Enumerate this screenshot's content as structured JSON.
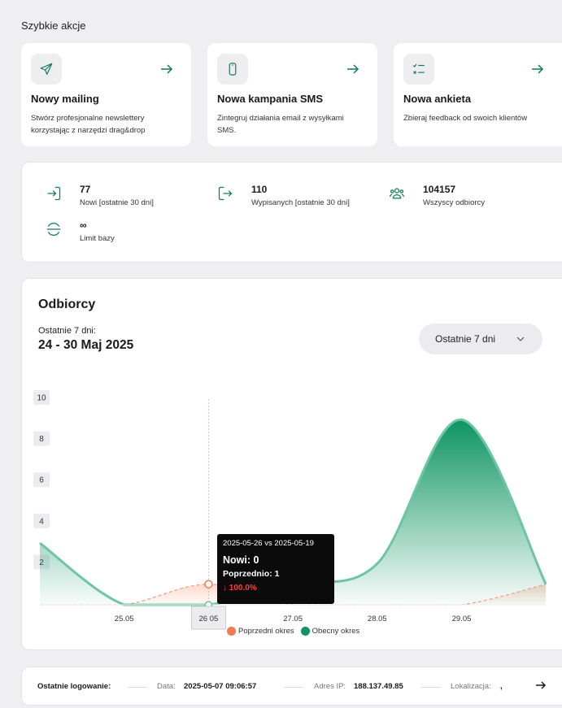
{
  "quick_actions": {
    "title": "Szybkie akcje",
    "items": [
      {
        "icon": "paper-plane-icon",
        "title": "Nowy mailing",
        "description": "Stwórz profesjonalne newslettery korzystając z narzędzi drag&drop"
      },
      {
        "icon": "mobile-phone-icon",
        "title": "Nowa kampania SMS",
        "description": "Zintegruj działania email z wysyłkami SMS."
      },
      {
        "icon": "checklist-icon",
        "title": "Nowa ankieta",
        "description": "Zbieraj feedback od swoich klientów"
      }
    ]
  },
  "stats": [
    {
      "icon": "sign-in-icon",
      "value": "77",
      "label": "Nowi [ostatnie 30 dni]"
    },
    {
      "icon": "sign-out-icon",
      "value": "110",
      "label": "Wypisanych [ostatnie 30 dni]"
    },
    {
      "icon": "users-group-icon",
      "value": "104157",
      "label": "Wszyscy odbiorcy"
    },
    {
      "icon": "database-limit-icon",
      "value": "∞",
      "label": "Limit bazy"
    }
  ],
  "chart_card": {
    "title": "Odbiorcy",
    "period_label": "Ostatnie 7 dni:",
    "period_range": "24 - 30 Maj 2025",
    "range_select": "Ostatnie 7 dni",
    "tooltip": {
      "header": "2025-05-26 vs 2025-05-19",
      "main": "Nowi: 0",
      "previous": "Poprzednio: 1",
      "change": "↓ 100.0%"
    },
    "active_x_label": "26 05"
  },
  "chart_data": {
    "type": "area",
    "x": [
      "24.05",
      "25.05",
      "26.05",
      "27.05",
      "28.05",
      "29.05",
      "30.05"
    ],
    "x_tick_labels": [
      "25.05",
      "27.05",
      "28.05",
      "29.05"
    ],
    "y_ticks": [
      2,
      4,
      6,
      8,
      10
    ],
    "ylim": [
      0,
      10
    ],
    "series": [
      {
        "name": "Poprzedni okres",
        "values": [
          0,
          0,
          1,
          0,
          0,
          0,
          1
        ],
        "color": "#f47a4e"
      },
      {
        "name": "Obecny okres",
        "values": [
          3,
          0,
          0,
          1,
          2,
          9,
          1
        ],
        "color": "#0d9463"
      }
    ],
    "active_index": 2
  },
  "last_login": {
    "title": "Ostatnie logowanie:",
    "date_label": "Data:",
    "date_value": "2025-05-07 09:06:57",
    "ip_label": "Adres IP:",
    "ip_value": "188.137.49.85",
    "location_label": "Lokalizacja:",
    "location_value": ","
  }
}
